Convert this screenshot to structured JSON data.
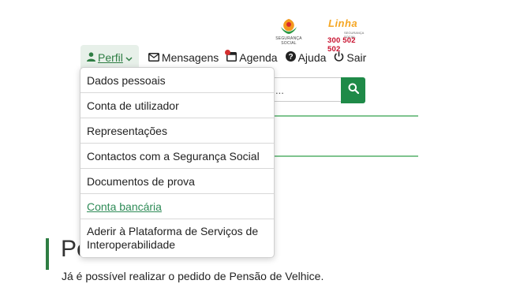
{
  "logos": {
    "ss_text": "SEGURANÇA SOCIAL",
    "linha_word": "Linha",
    "linha_sub": "SEGURANÇA SOCIAL",
    "linha_number": "300 502 502"
  },
  "nav": {
    "perfil": "Perfil",
    "mensagens": "Mensagens",
    "agenda": "Agenda",
    "ajuda": "Ajuda",
    "sair": "Sair"
  },
  "search": {
    "visible_text": "..."
  },
  "dropdown": {
    "items": [
      "Dados pessoais",
      "Conta de utilizador",
      "Representações",
      "Contactos com a Segurança Social",
      "Documentos de prova",
      "Conta bancária",
      "Aderir à Plataforma de Serviços de Interoperabilidade"
    ],
    "active_index": 5
  },
  "page": {
    "title_visible": "Pe",
    "text": "Já é possível realizar o pedido de Pensão de Velhice."
  },
  "colors": {
    "brand_green": "#2e7d43",
    "search_button": "#1f8a48",
    "linha_orange": "#f5a623",
    "linha_red": "#c8102e",
    "notification_dot": "#d32f2f"
  }
}
